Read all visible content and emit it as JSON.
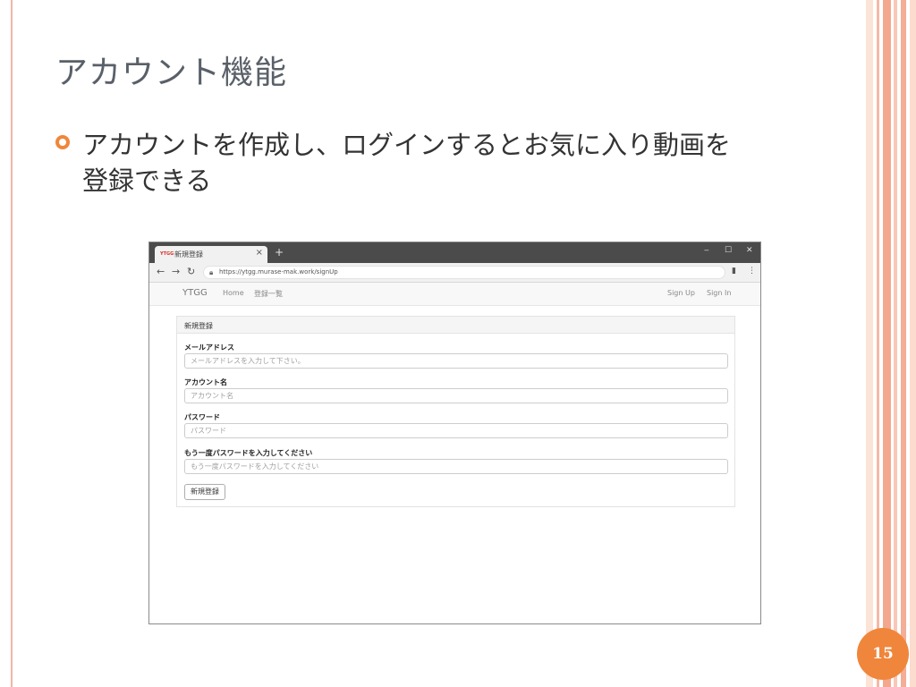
{
  "slide": {
    "title": "アカウント機能",
    "bullet_line1": "アカウントを作成し、ログインするとお気に入り動画を",
    "bullet_line2": "登録できる",
    "page_number": "15",
    "accent_color": "#f0863b"
  },
  "browser": {
    "tab_favicon": "YTGG",
    "tab_title": "新規登録",
    "tab_close": "×",
    "new_tab": "+",
    "window_controls": [
      "‒",
      "☐",
      "✕"
    ],
    "url": "https://ytgg.murase-mak.work/signUp",
    "app": {
      "brand": "YTGG",
      "nav_left": [
        "Home",
        "登録一覧"
      ],
      "nav_right": [
        "Sign Up",
        "Sign In"
      ]
    },
    "form": {
      "heading": "新規登録",
      "fields": [
        {
          "label": "メールアドレス",
          "placeholder": "メールアドレスを入力して下さい。"
        },
        {
          "label": "アカウント名",
          "placeholder": "アカウント名"
        },
        {
          "label": "パスワード",
          "placeholder": "パスワード"
        },
        {
          "label": "もう一度パスワードを入力してください",
          "placeholder": "もう一度パスワードを入力してください"
        }
      ],
      "submit_label": "新規登録"
    }
  }
}
